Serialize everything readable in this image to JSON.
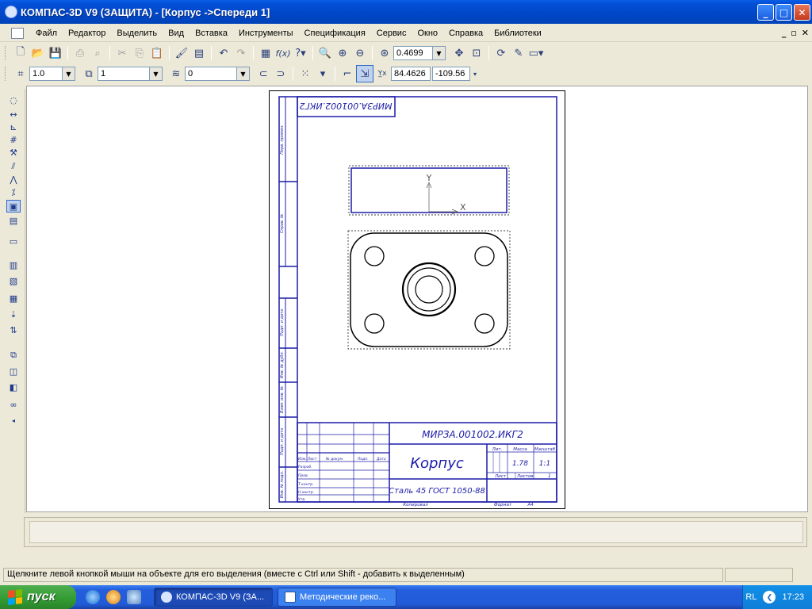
{
  "window": {
    "title": "КОМПАС-3D V9 (ЗАЩИТА) - [Корпус ->Спереди 1]",
    "controls": {
      "minimize": "_",
      "maximize": "□",
      "close": "✕"
    }
  },
  "menu": {
    "items": [
      "Файл",
      "Редактор",
      "Выделить",
      "Вид",
      "Вставка",
      "Инструменты",
      "Спецификация",
      "Сервис",
      "Окно",
      "Справка",
      "Библиотеки"
    ],
    "doc_controls": [
      "_",
      "▫",
      "✕"
    ]
  },
  "toolbar1": {
    "zoom_value": "0.4699"
  },
  "toolbar2": {
    "style_value": "1.0",
    "view_value": "1",
    "layer_value": "0",
    "coord_x": "84.4626",
    "coord_y": "-109.56"
  },
  "drawing": {
    "designation": "МИРЗА.001002.ИКГ2",
    "designation_mirrored": "МИРЗА.001002.ИКГ2",
    "part_name": "Корпус",
    "material": "Сталь 45  ГОСТ 1050-88",
    "mass": "1.78",
    "scale": "1:1",
    "lit_header": "Лит.",
    "mass_header": "Масса",
    "scale_header": "Масштаб",
    "sheet_label": "Лист",
    "sheets_label": "Листов",
    "sheets_count": "1",
    "copied_label": "Копировал",
    "format_label": "Формат",
    "format_value": "А4",
    "axis_y": "Y",
    "axis_x": "X",
    "rows": {
      "izm": "Изм.",
      "list": "Лист",
      "doc": "№ докум.",
      "sign": "Подп.",
      "date": "Дата",
      "razrab": "Разраб.",
      "prov": "Пров.",
      "tkontr": "Т.контр.",
      "nkontr": "Н.контр.",
      "utv": "Утв."
    },
    "side_labels": [
      "Перв. примен.",
      "Справ. №",
      "Подп. и дата",
      "Инв. № дубл.",
      "Взам. инв. №",
      "Подп. и дата",
      "Инв. № подл."
    ]
  },
  "statusbar": {
    "message": "Щелкните левой кнопкой мыши на объекте для его выделения (вместе с Ctrl или Shift - добавить к выделенным)"
  },
  "taskbar": {
    "start_label": "пуск",
    "tasks": [
      "КОМПАС-3D V9 (ЗА...",
      "Методические реко..."
    ],
    "lang": "RL",
    "clock": "17:23"
  },
  "colors": {
    "drawing_blue": "#1c1ca8",
    "titlebar_blue": "#0350d6",
    "start_green": "#329a32"
  }
}
